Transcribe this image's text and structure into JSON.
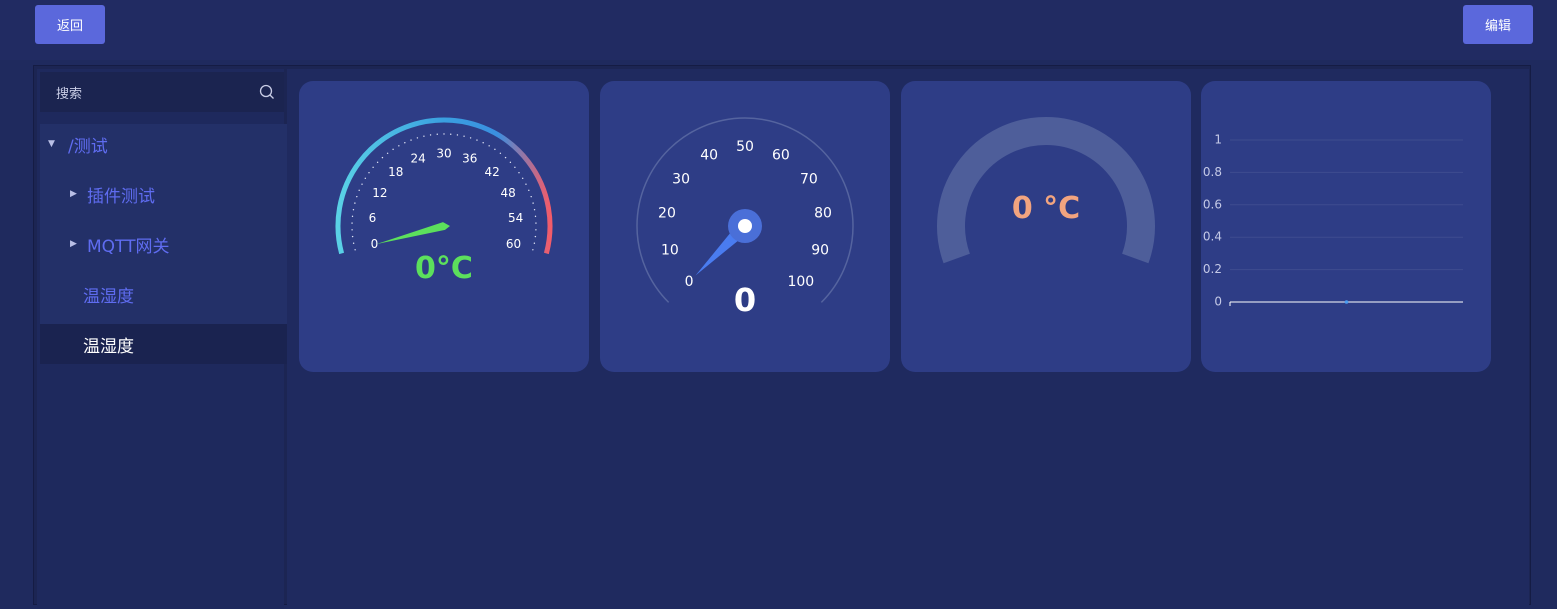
{
  "toolbar": {
    "back_label": "返回",
    "edit_label": "编辑"
  },
  "sidebar": {
    "search_placeholder": "搜索",
    "tree": {
      "root": "/测试",
      "children": [
        {
          "label": "插件测试",
          "expandable": true
        },
        {
          "label": "MQTT网关",
          "expandable": true
        },
        {
          "label": "温湿度",
          "expandable": false
        }
      ],
      "selected": "温湿度"
    }
  },
  "colors": {
    "accent": "#5b68dc",
    "card_bg": "#2e3d86",
    "tree_text": "#5f6cf0",
    "green_value": "#5ce05c",
    "orange_value": "#f2a47f",
    "needle_blue": "#4a7cf0"
  },
  "widgets": {
    "gauge1": {
      "value_text": "0°C",
      "ticks": [
        "0",
        "6",
        "12",
        "18",
        "24",
        "30",
        "36",
        "42",
        "48",
        "54",
        "60"
      ]
    },
    "gauge2": {
      "value_text": "0",
      "ticks": [
        "0",
        "10",
        "20",
        "30",
        "40",
        "50",
        "60",
        "70",
        "80",
        "90",
        "100"
      ]
    },
    "gauge3": {
      "value_text": "0 °C"
    },
    "line_chart": {
      "y_ticks": [
        "1",
        "0.8",
        "0.6",
        "0.4",
        "0.2",
        "0"
      ]
    }
  },
  "chart_data": {
    "type": "line",
    "y": [
      0
    ],
    "ylim": [
      0,
      1
    ],
    "yticks": [
      0,
      0.2,
      0.4,
      0.6,
      0.8,
      1
    ],
    "grid": true,
    "title": "",
    "xlabel": "",
    "ylabel": ""
  }
}
